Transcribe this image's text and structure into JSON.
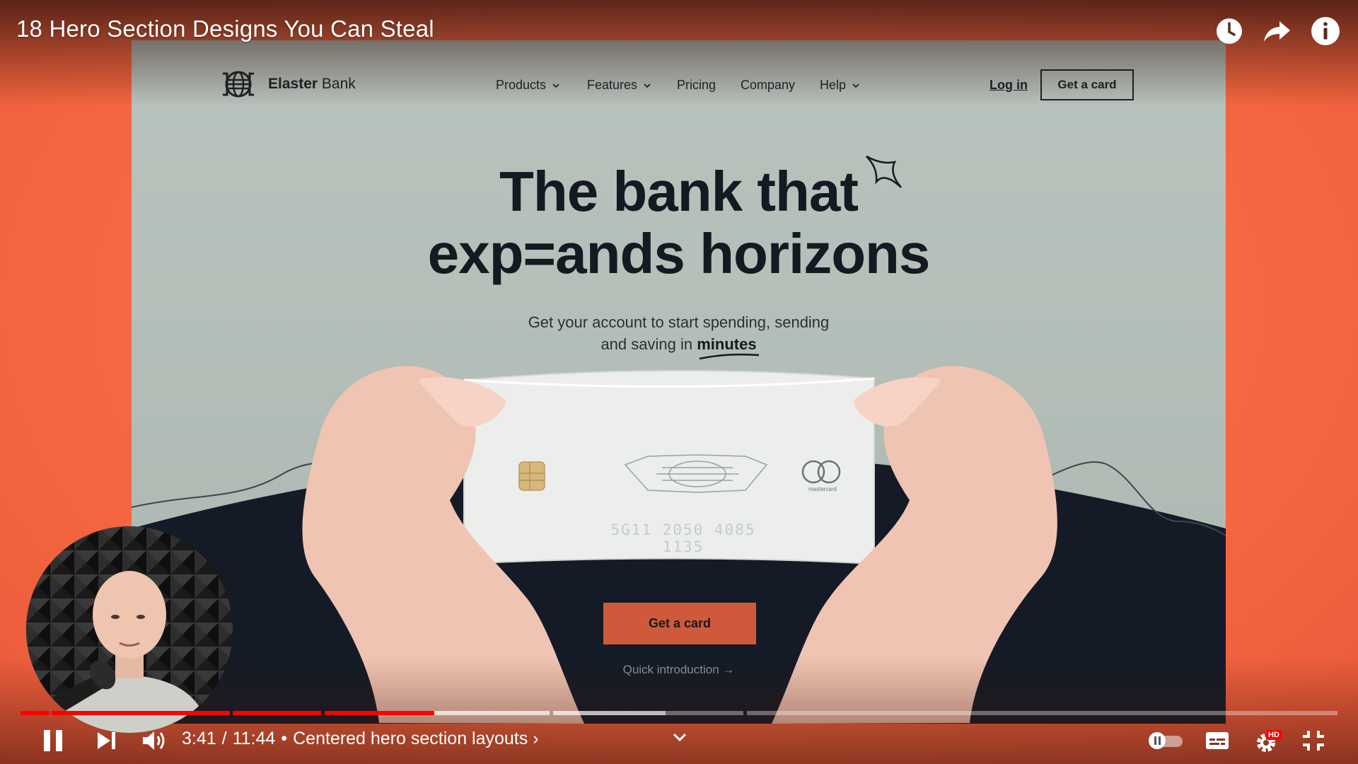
{
  "video": {
    "title": "18 Hero Section Designs You Can Steal",
    "current_time": "3:41",
    "duration": "11:44",
    "time_separator": "/",
    "chapter_bullet": "•",
    "chapter": "Centered hero section layouts",
    "chapter_arrow": "›",
    "progress": 0.314,
    "buffered": 0.49
  },
  "top_actions": [
    {
      "name": "watch-later",
      "icon": "clock-icon"
    },
    {
      "name": "share",
      "icon": "share-arrow-icon"
    },
    {
      "name": "info",
      "icon": "info-icon"
    }
  ],
  "site": {
    "brand_bold": "Elaster",
    "brand_light": " Bank",
    "nav": [
      "Products",
      "Features",
      "Pricing",
      "Company",
      "Help"
    ],
    "login": "Log in",
    "nav_cta": "Get a card",
    "headline_line1": "The bank that",
    "headline_line2": "exp=ands horizons",
    "sub_line1": "Get your account to start spending, sending",
    "sub_line2_a": "and saving in ",
    "sub_line2_em": "minutes",
    "card_number": "5G11 2050 4085 1135",
    "card_brand": "mastercard",
    "cta": "Get a card",
    "intro": "Quick introduction →"
  },
  "controls": {
    "autoplay": "autoplay-toggle",
    "captions": "captions-icon",
    "settings_badge": "HD",
    "fullscreen": "exit-fullscreen-icon"
  },
  "colors": {
    "frame": "#f26f4d",
    "site_bg": "#b5c0ba",
    "site_cta": "#cf5a3b",
    "dark_hill": "#141b27",
    "progress": "#ff0000"
  }
}
